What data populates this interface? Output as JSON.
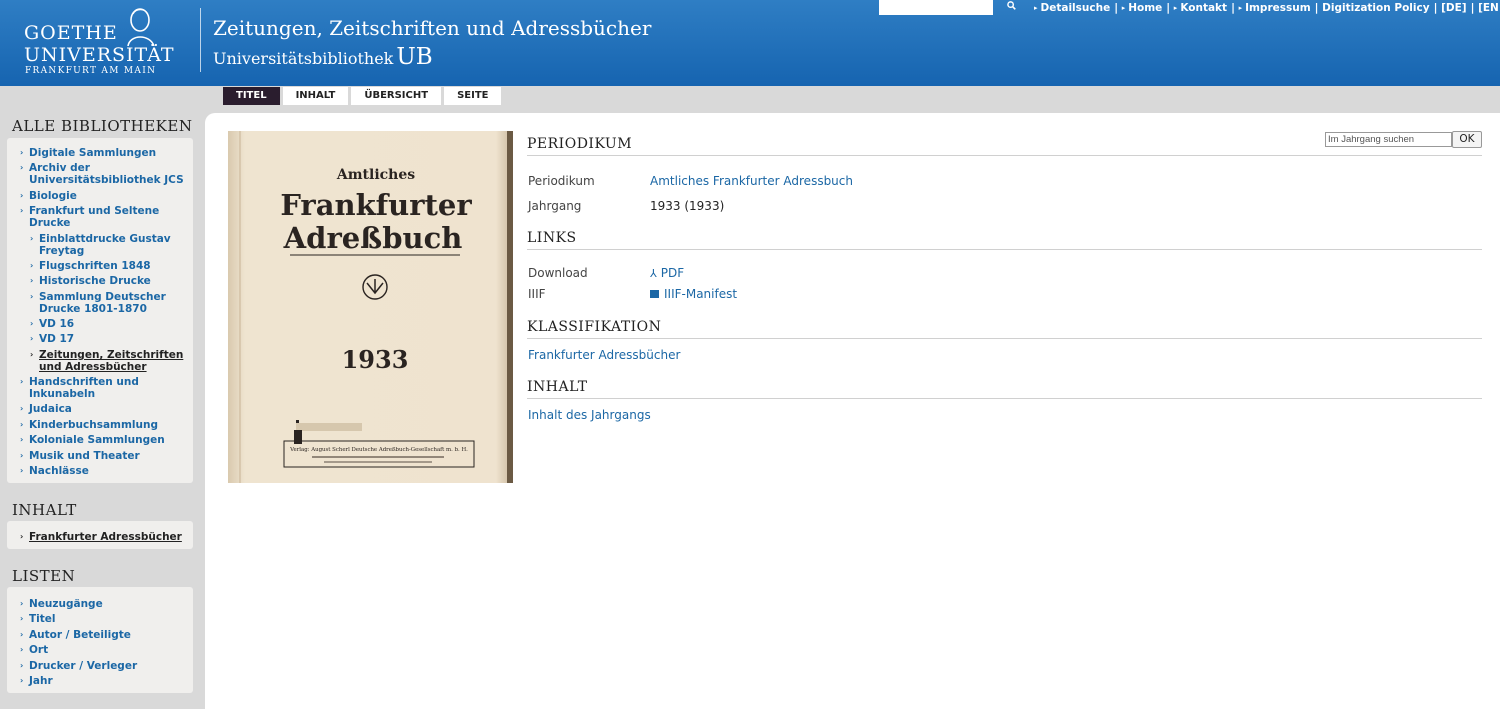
{
  "header": {
    "logo": {
      "line1": "GOETHE",
      "line2": "UNIVERSITÄT",
      "line3": "FRANKFURT AM MAIN"
    },
    "title": "Zeitungen, Zeitschriften und Adressbücher",
    "subtitle": "Universitätsbibliothek",
    "subtitle_ub": "UB",
    "search_icon": "search-icon",
    "nav": [
      {
        "label": "Detailsuche",
        "prefix": "",
        "arrow": true
      },
      {
        "label": "Home",
        "prefix": "| ",
        "arrow": true
      },
      {
        "label": "Kontakt",
        "prefix": "| ",
        "arrow": true
      },
      {
        "label": "Impressum",
        "prefix": "| ",
        "arrow": true
      },
      {
        "label": "Digitization Policy",
        "prefix": "| ",
        "arrow": false
      },
      {
        "label": "[DE]",
        "prefix": "| ",
        "arrow": false
      },
      {
        "label": "[EN",
        "prefix": "| ",
        "arrow": false
      }
    ]
  },
  "tabs": [
    "TITEL",
    "INHALT",
    "ÜBERSICHT",
    "SEITE"
  ],
  "sidebar": {
    "libraries_heading": "ALLE BIBLIOTHEKEN",
    "libraries": [
      {
        "label": "Digitale Sammlungen"
      },
      {
        "label": "Archiv der Universitätsbibliothek JCS"
      },
      {
        "label": "Biologie"
      },
      {
        "label": "Frankfurt und Seltene Drucke"
      },
      {
        "label": "Einblattdrucke Gustav Freytag"
      },
      {
        "label": "Flugschriften 1848"
      },
      {
        "label": "Historische Drucke"
      },
      {
        "label": "Sammlung Deutscher Drucke 1801-1870"
      },
      {
        "label": "VD 16"
      },
      {
        "label": "VD 17"
      },
      {
        "label": "Zeitungen, Zeitschriften und Adressbücher"
      },
      {
        "label": "Handschriften und Inkunabeln"
      },
      {
        "label": "Judaica"
      },
      {
        "label": "Kinderbuchsammlung"
      },
      {
        "label": "Koloniale Sammlungen"
      },
      {
        "label": "Musik und Theater"
      },
      {
        "label": "Nachlässe"
      }
    ],
    "content_heading": "INHALT",
    "content_items": [
      {
        "label": "Frankfurter Adressbücher"
      }
    ],
    "lists_heading": "LISTEN",
    "lists": [
      {
        "label": "Neuzugänge"
      },
      {
        "label": "Titel"
      },
      {
        "label": "Autor / Beteiligte"
      },
      {
        "label": "Ort"
      },
      {
        "label": "Drucker / Verleger"
      },
      {
        "label": "Jahr"
      }
    ]
  },
  "cover": {
    "line1": "Amtliches",
    "line2": "Frankfurter",
    "line3": "Adreßbuch",
    "year": "1933",
    "publisher": "Verlag: August Scherl Deutsche Adreßbuch-Gesellschaft m. b. H."
  },
  "year_search": {
    "placeholder": "Im Jahrgang suchen",
    "button": "OK"
  },
  "main": {
    "periodikum_heading": "PERIODIKUM",
    "periodikum_label": "Periodikum",
    "periodikum_value": "Amtliches Frankfurter Adressbuch",
    "jahrgang_label": "Jahrgang",
    "jahrgang_value": "1933 (1933)",
    "links_heading": "LINKS",
    "download_label": "Download",
    "pdf_link": "PDF",
    "iiif_label": "IIIF",
    "iiif_link": "IIIF-Manifest",
    "klass_heading": "KLASSIFIKATION",
    "klass_link": "Frankfurter Adressbücher",
    "inhalt_heading": "INHALT",
    "inhalt_link": "Inhalt des Jahrgangs"
  }
}
